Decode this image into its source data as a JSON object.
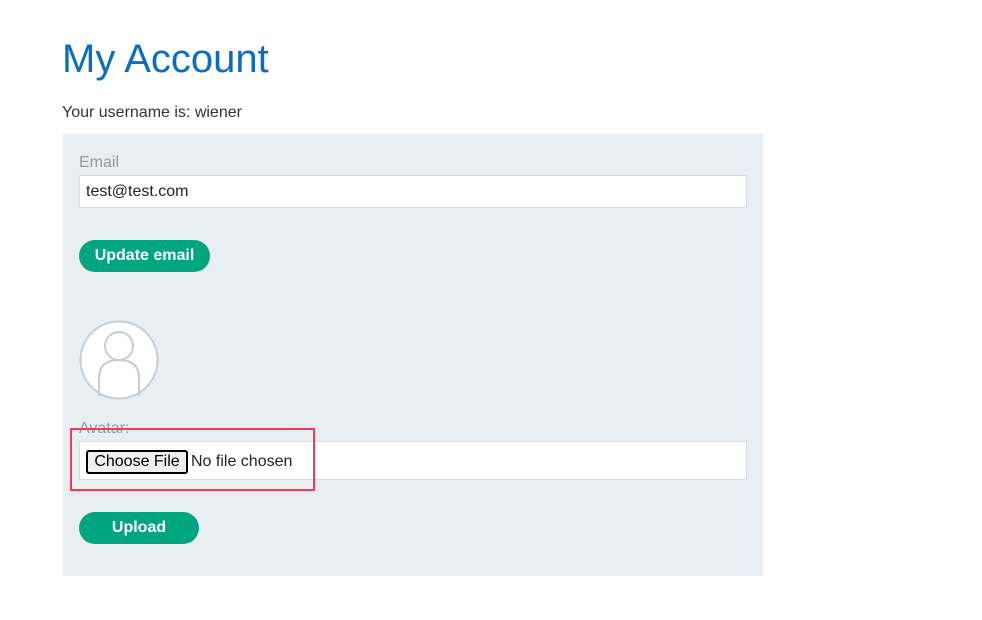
{
  "page": {
    "title": "My Account",
    "username_text": "Your username is: wiener"
  },
  "email_form": {
    "label": "Email",
    "value": "test@test.com",
    "submit_label": "Update email"
  },
  "avatar_form": {
    "label": "Avatar:",
    "choose_file_label": "Choose File",
    "file_status": "No file chosen",
    "submit_label": "Upload"
  },
  "colors": {
    "title": "#0a6ebd",
    "button": "#00a680",
    "panel": "#e8eef1",
    "highlight": "#ee3b57"
  },
  "icons": {
    "avatar": "user-avatar-icon"
  }
}
